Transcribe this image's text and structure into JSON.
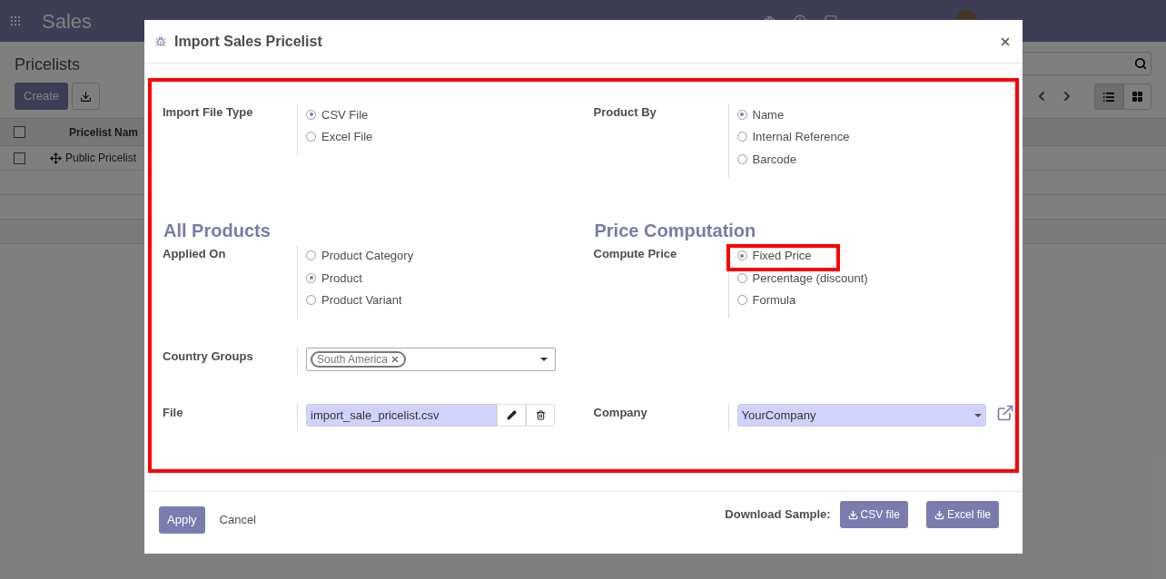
{
  "navbar": {
    "app": "Sales"
  },
  "control_panel": {
    "title": "Pricelists",
    "create_button": "Create"
  },
  "list": {
    "all_selected": false,
    "columns": [
      "Pricelist Nam"
    ],
    "rows": [
      {
        "name": "Public Pricelist",
        "selected": false
      }
    ]
  },
  "dialog": {
    "title": "Import Sales Pricelist",
    "highlighted": true,
    "rows": [
      {
        "cells": [
          {
            "kind": "radio",
            "label": "Import File Type",
            "options": [
              {
                "label": "CSV File",
                "selected": true,
                "highlighted": false
              },
              {
                "label": "Excel File",
                "selected": false,
                "highlighted": false
              }
            ]
          },
          {
            "kind": "radio",
            "label": "Product By",
            "options": [
              {
                "label": "Name",
                "selected": true,
                "highlighted": false
              },
              {
                "label": "Internal Reference",
                "selected": false,
                "highlighted": false
              },
              {
                "label": "Barcode",
                "selected": false,
                "highlighted": false
              }
            ]
          }
        ]
      },
      {
        "cells": [
          {
            "kind": "heading",
            "text": "All Products"
          },
          {
            "kind": "heading",
            "text": "Price Computation"
          }
        ]
      },
      {
        "cells": [
          {
            "kind": "radio",
            "label": "Applied On",
            "options": [
              {
                "label": "Product Category",
                "selected": false,
                "highlighted": false
              },
              {
                "label": "Product",
                "selected": true,
                "highlighted": false
              },
              {
                "label": "Product Variant",
                "selected": false,
                "highlighted": false
              }
            ]
          },
          {
            "kind": "radio",
            "label": "Compute Price",
            "options": [
              {
                "label": "Fixed Price",
                "selected": true,
                "highlighted": true
              },
              {
                "label": "Percentage (discount)",
                "selected": false,
                "highlighted": false
              },
              {
                "label": "Formula",
                "selected": false,
                "highlighted": false
              }
            ]
          }
        ]
      },
      {
        "cells": [
          {
            "kind": "tags",
            "label": "Country Groups",
            "tags": [
              "South America"
            ]
          }
        ]
      },
      {
        "cells": [
          {
            "kind": "file",
            "label": "File",
            "value": "import_sale_pricelist.csv"
          },
          {
            "kind": "select",
            "label": "Company",
            "value": "YourCompany"
          }
        ]
      }
    ],
    "footer": {
      "apply": "Apply",
      "cancel": "Cancel",
      "download_label": "Download Sample:",
      "downloads": [
        "CSV file",
        "Excel file"
      ]
    }
  }
}
